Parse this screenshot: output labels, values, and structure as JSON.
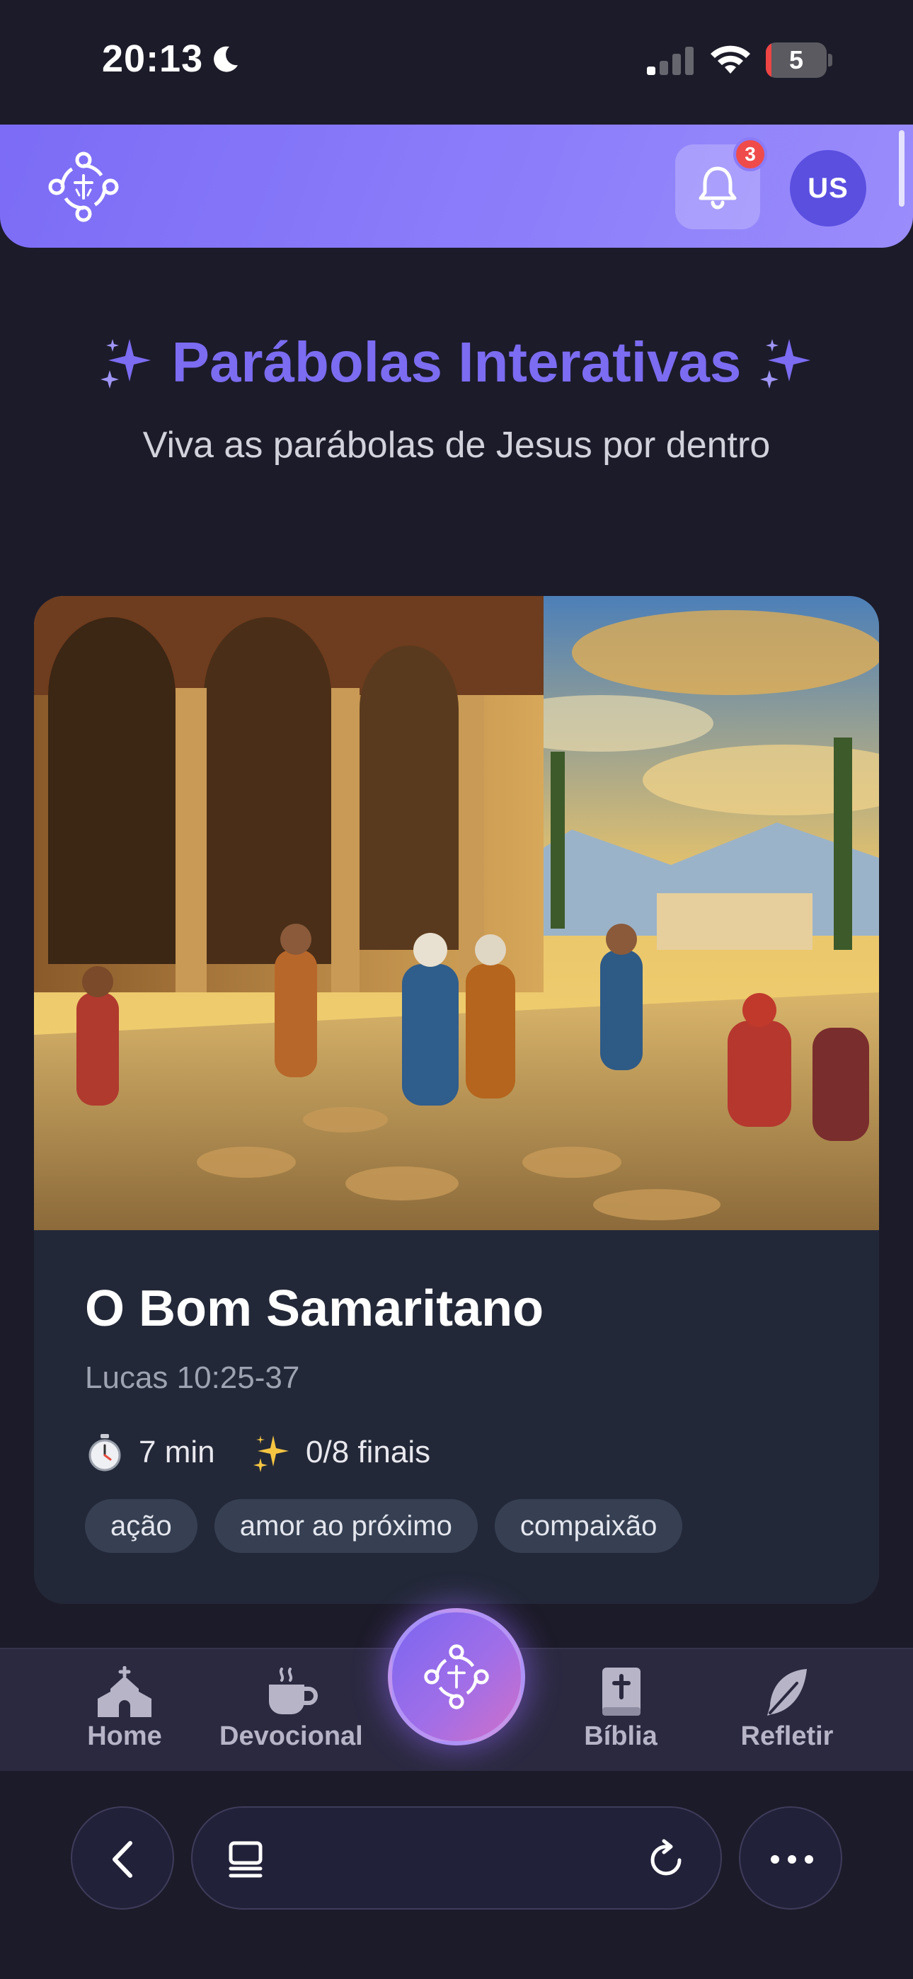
{
  "status_bar": {
    "time": "20:13",
    "battery_level": "5",
    "icons": [
      "moon-icon",
      "cellular-signal-icon",
      "wifi-icon",
      "battery-icon"
    ]
  },
  "header": {
    "logo_icon": "app-logo-icon",
    "notifications_icon": "bell-icon",
    "notification_count": "3",
    "avatar_initials": "US",
    "accent": "#7c6cf6"
  },
  "page": {
    "title": "Parábolas Interativas",
    "title_icon": "sparkles-icon",
    "subtitle": "Viva as parábolas de Jesus por dentro"
  },
  "parable_card": {
    "image_icon": "parable-illustration",
    "title": "O Bom Samaritano",
    "reference": "Lucas 10:25-37",
    "duration": "7 min",
    "duration_icon": "stopwatch-icon",
    "endings": "0/8 finais",
    "endings_icon": "sparkles-icon",
    "tags": [
      "ação",
      "amor ao próximo",
      "compaixão"
    ]
  },
  "bottom_nav": {
    "items": [
      {
        "label": "Home",
        "icon": "church-icon"
      },
      {
        "label": "Devocional",
        "icon": "coffee-cup-icon"
      },
      {
        "label": "Bíblia",
        "icon": "bible-icon"
      },
      {
        "label": "Refletir",
        "icon": "feather-icon"
      }
    ],
    "center_icon": "app-logo-icon"
  },
  "browser_toolbar": {
    "icons": [
      "back-icon",
      "tabs-icon",
      "reload-icon",
      "more-icon"
    ]
  }
}
